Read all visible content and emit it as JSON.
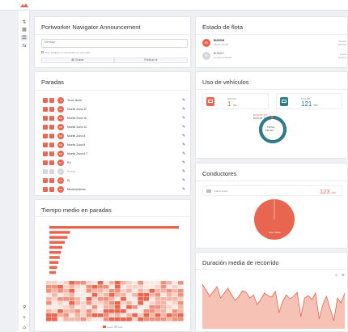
{
  "header": {
    "logo": "logo-mark"
  },
  "sidebar": {
    "icons": [
      "swap-icon",
      "grid-icon",
      "list-icon",
      "tab-icon"
    ],
    "bottom_icons": [
      "user-icon",
      "plus-icon",
      "home-icon"
    ]
  },
  "announcement": {
    "title": "Portworker Navigator Announcement",
    "message_placeholder": "Mensaje",
    "checkbox_label": "Solo publicar en conectados en ordenado",
    "btn_left": "Grabar",
    "btn_right": "Publicar"
  },
  "fleet": {
    "title": "Estado de flota",
    "items": [
      {
        "badge": "B1",
        "name": "BUS006",
        "sub": "Muelle Zona6",
        "status": "Tiempo\nparadas",
        "accent": true
      },
      {
        "badge": "B0",
        "name": "BUS007",
        "sub": "Cocheras Muelle",
        "status": "Fuera\nservicio",
        "accent": false
      }
    ]
  },
  "stops": {
    "title": "Paradas",
    "rows": [
      {
        "badge": "TA",
        "label": "Torno Norte",
        "muted": false
      },
      {
        "badge": "MZ",
        "label": "Muelle Zona 12",
        "muted": false
      },
      {
        "badge": "MZ",
        "label": "Muelle Zona 11",
        "muted": false
      },
      {
        "badge": "MZ",
        "label": "Muelle Zona 10",
        "muted": false
      },
      {
        "badge": "MZ",
        "label": "Muelle Zona 8",
        "muted": false
      },
      {
        "badge": "MZ",
        "label": "Muelle Zona 8",
        "muted": false
      },
      {
        "badge": "MZ",
        "label": "Muelle Zona 6 7",
        "muted": false
      },
      {
        "badge": "RV",
        "label": "RV",
        "muted": false
      },
      {
        "badge": "P",
        "label": "Puerta",
        "muted": true
      },
      {
        "badge": "EJ",
        "label": "Ej",
        "muted": false
      },
      {
        "badge": "MA",
        "label": "Mantenimiento",
        "muted": false
      }
    ]
  },
  "vehicle_use": {
    "title": "Uso de vehículos",
    "stat_left_label": "BUS007",
    "stat_left_value": "1",
    "stat_left_unit": "hrs",
    "stat_right_label": "BUS006",
    "stat_right_value": "121",
    "stat_right_unit": "hrs",
    "donut_label_1": "BUS007: 2%",
    "donut_label_2": "BUS006: 98%",
    "donut_total_label": "TOTAL",
    "donut_total_value": "122 hrs",
    "donut_share_bus006": 0.98
  },
  "drivers": {
    "title": "Conductores",
    "name": "Marco Dávis",
    "value": "123",
    "unit": "hrs",
    "pie_label": "Ana, Marta"
  },
  "avg_stop_time": {
    "title": "Tiempo medio en paradas",
    "bars": [
      1,
      0.16,
      0.14,
      0.12,
      0.1,
      0.09,
      0.08,
      0.07,
      0.06,
      0.05
    ],
    "legend_1": "Datos",
    "legend_2": "Max"
  },
  "avg_trip": {
    "title": "Duración media de recorrido",
    "toolbar_icons": [
      "zoom-icon",
      "download-icon"
    ],
    "series": [
      55,
      48,
      40,
      46,
      52,
      38,
      44,
      50,
      42,
      35,
      40,
      47,
      45,
      38,
      42,
      30,
      36,
      44,
      41,
      39,
      46,
      20,
      34,
      42,
      37,
      40,
      45,
      15,
      38,
      41,
      36,
      44,
      12,
      30,
      40,
      25,
      10,
      38,
      32,
      44
    ]
  },
  "colors": {
    "accent": "#e8664f",
    "teal": "#2c7b8c",
    "grey": "#d5d7db"
  }
}
